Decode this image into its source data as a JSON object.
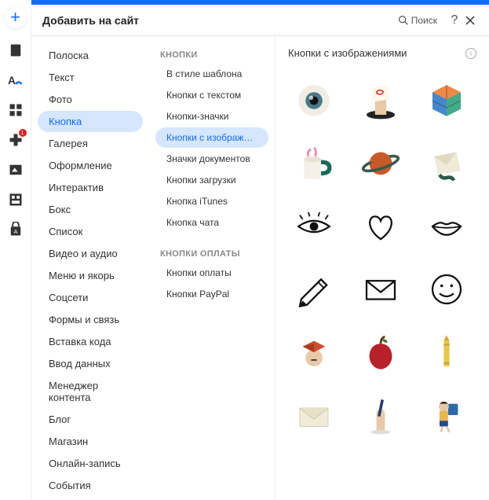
{
  "header": {
    "title": "Добавить на сайт",
    "search_label": "Поиск"
  },
  "rail_badge": "1",
  "col1": {
    "items": [
      "Полоска",
      "Текст",
      "Фото",
      "Кнопка",
      "Галерея",
      "Оформление",
      "Интерактив",
      "Бокс",
      "Список",
      "Видео и аудио",
      "Меню и якорь",
      "Соцсети",
      "Формы и связь",
      "Вставка кода",
      "Ввод данных",
      "Менеджер контента",
      "Блог",
      "Магазин",
      "Онлайн-запись",
      "События"
    ],
    "selected": 3
  },
  "col2": {
    "groups": [
      {
        "heading": "КНОПКИ",
        "items": [
          "В стиле шаблона",
          "Кнопки с текстом",
          "Кнопки-значки",
          "Кнопки с изображ…",
          "Значки документов",
          "Кнопки загрузки",
          "Кнопка iTunes",
          "Кнопка чата"
        ],
        "selected": 3
      },
      {
        "heading": "КНОПКИ ОПЛАТЫ",
        "items": [
          "Кнопки оплаты",
          "Кнопки PayPal"
        ],
        "selected": -1
      }
    ]
  },
  "col3": {
    "title": "Кнопки с изображениями",
    "thumbs": [
      "eyeball",
      "hand-card",
      "cube",
      "mug",
      "planet",
      "envelope-3d",
      "eye-line",
      "heart-line",
      "lips-line",
      "pencil-line",
      "mail-line",
      "smiley-line",
      "book-head",
      "apple",
      "crayon",
      "envelope-flat",
      "hand-pen",
      "schoolgirl"
    ]
  }
}
